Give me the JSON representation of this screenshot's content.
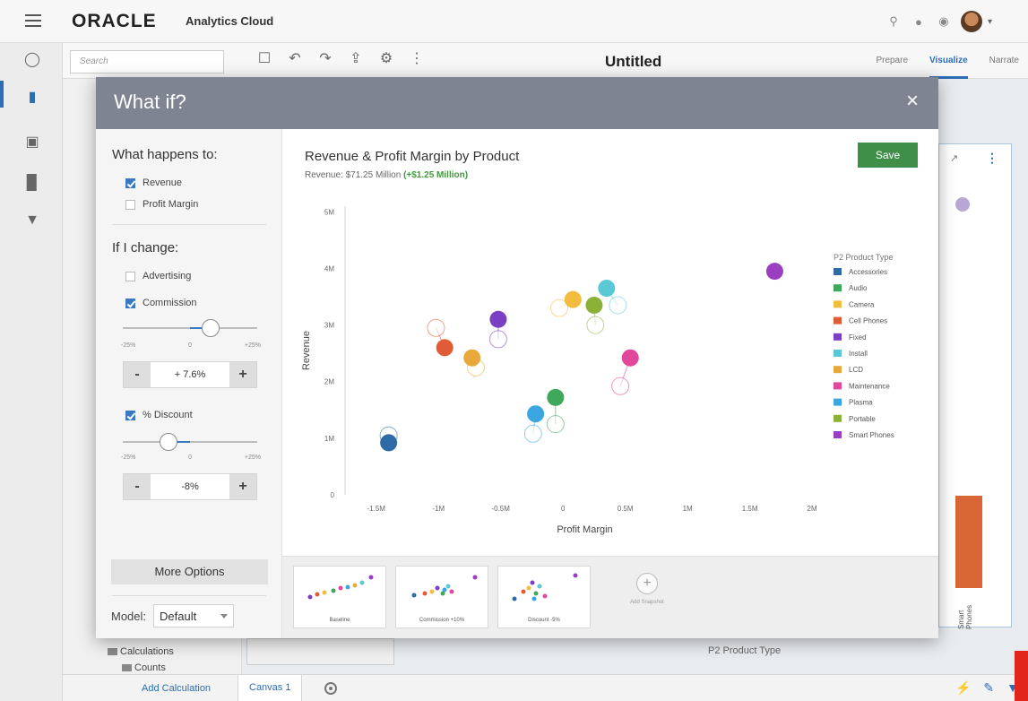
{
  "app": {
    "logo": "ORACLE",
    "product": "Analytics Cloud",
    "doc_title": "Untitled",
    "search_placeholder": "Search",
    "modes": [
      "Prepare",
      "Visualize",
      "Narrate"
    ],
    "active_mode": "Visualize"
  },
  "background": {
    "axis_title": "P2 Product Type",
    "bar_label": "Smart Phones",
    "tree": [
      "Calculations",
      "Counts"
    ],
    "add_calculation": "Add Calculation",
    "canvas_tab": "Canvas 1"
  },
  "modal": {
    "title": "What if?",
    "close": "×",
    "what_happens_to": "What happens to:",
    "targets": [
      {
        "label": "Revenue",
        "checked": true
      },
      {
        "label": "Profit Margin",
        "checked": false
      }
    ],
    "if_i_change": "If I change:",
    "drivers": [
      {
        "label": "Advertising",
        "checked": false
      },
      {
        "label": "Commission",
        "checked": true,
        "value_text": "+ 7.6%",
        "slider_fraction": 0.65
      },
      {
        "label": "% Discount",
        "checked": true,
        "value_text": "-8%",
        "slider_fraction": 0.34
      }
    ],
    "slider_ticks": [
      "-25%",
      "0",
      "+25%"
    ],
    "minus": "-",
    "plus": "+",
    "more_options": "More Options",
    "model_label": "Model:",
    "model_value": "Default",
    "save": "Save",
    "chart_title": "Revenue & Profit Margin by Product",
    "subtitle_prefix": "Revenue: $71.25 Million",
    "subtitle_delta": "(+$1.25 Million)",
    "snapshots": [
      "Baseline",
      "Commission +10%",
      "Discount -5%"
    ],
    "add_snapshot": "Add Snapshot"
  },
  "chart_data": {
    "type": "scatter",
    "title": "Revenue & Profit Margin by Product",
    "xlabel": "Profit Margin",
    "ylabel": "Revenue",
    "xlim": [
      -1.75,
      2.1
    ],
    "ylim": [
      0,
      5.1
    ],
    "x_ticks": [
      -1.5,
      -1,
      -0.5,
      0,
      0.5,
      1,
      1.5,
      2
    ],
    "x_tick_labels": [
      "-1.5M",
      "-1M",
      "-0.5M",
      "0",
      "0.5M",
      "1M",
      "1.5M",
      "2M"
    ],
    "y_ticks": [
      0,
      1,
      2,
      3,
      4,
      5
    ],
    "y_tick_labels": [
      "0",
      "1M",
      "2M",
      "3M",
      "4M",
      "5M"
    ],
    "legend_title": "P2 Product Type",
    "legend_position": "right",
    "series": [
      {
        "name": "Accessories",
        "color": "#2f6aa6",
        "x": -1.4,
        "y": 0.92,
        "baseline_x": -1.4,
        "baseline_y": 1.05
      },
      {
        "name": "Audio",
        "color": "#3fa85a",
        "x": -0.06,
        "y": 1.72,
        "baseline_x": -0.06,
        "baseline_y": 1.25
      },
      {
        "name": "Camera",
        "color": "#f2bc3f",
        "x": 0.08,
        "y": 3.45,
        "baseline_x": -0.03,
        "baseline_y": 3.3
      },
      {
        "name": "Cell Phones",
        "color": "#e05c37",
        "x": -0.95,
        "y": 2.6,
        "baseline_x": -1.02,
        "baseline_y": 2.95
      },
      {
        "name": "Fixed",
        "color": "#7a3fc2",
        "x": -0.52,
        "y": 3.1,
        "baseline_x": -0.52,
        "baseline_y": 2.75
      },
      {
        "name": "Install",
        "color": "#5bc8d6",
        "x": 0.35,
        "y": 3.65,
        "baseline_x": 0.44,
        "baseline_y": 3.35
      },
      {
        "name": "LCD",
        "color": "#e9a93a",
        "x": -0.73,
        "y": 2.42,
        "baseline_x": -0.7,
        "baseline_y": 2.25
      },
      {
        "name": "Maintenance",
        "color": "#e1489b",
        "x": 0.54,
        "y": 2.42,
        "baseline_x": 0.46,
        "baseline_y": 1.92
      },
      {
        "name": "Plasma",
        "color": "#3aa7e2",
        "x": -0.22,
        "y": 1.43,
        "baseline_x": -0.24,
        "baseline_y": 1.08
      },
      {
        "name": "Portable",
        "color": "#8bb138",
        "x": 0.25,
        "y": 3.35,
        "baseline_x": 0.26,
        "baseline_y": 3.0
      },
      {
        "name": "Smart Phones",
        "color": "#9b3fc2",
        "x": 1.7,
        "y": 3.95
      }
    ]
  }
}
